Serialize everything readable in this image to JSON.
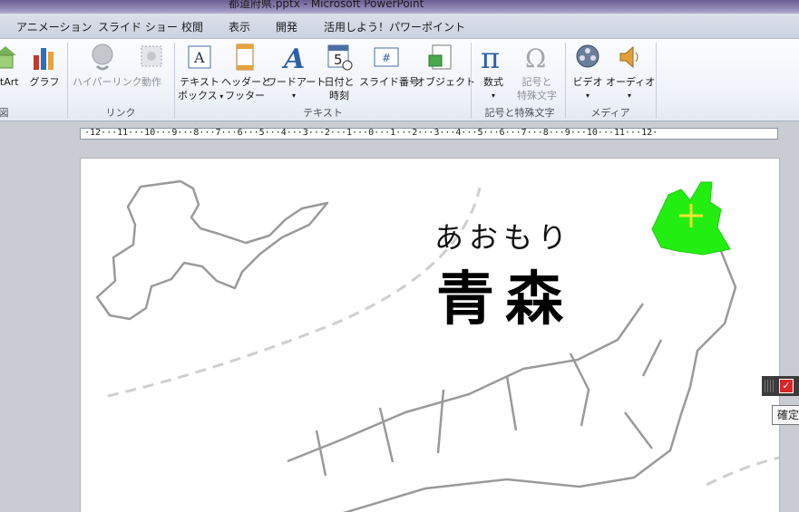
{
  "window": {
    "title": "都道府県.pptx - Microsoft PowerPoint"
  },
  "tabs": [
    "アニメーション",
    "スライド ショー",
    "校閲",
    "表示",
    "開発",
    "活用しよう！パワーポイント"
  ],
  "ribbon": {
    "partial_buttons": {
      "smartart": "rtArt",
      "graph": "グラフ"
    },
    "partial_group_label": "図",
    "links": {
      "hyperlink": "ハイパーリンク",
      "action": "動作",
      "group": "リンク"
    },
    "text": {
      "textbox": [
        "テキスト",
        "ボックス"
      ],
      "header_footer": [
        "ヘッダーと",
        "フッター"
      ],
      "wordart": "ワードアート",
      "datetime": [
        "日付と",
        "時刻"
      ],
      "slide_number": "スライド番号",
      "object": "オブジェクト",
      "group": "テキスト"
    },
    "symbols": {
      "equation": "数式",
      "symbol": [
        "記号と",
        "特殊文字"
      ],
      "group": "記号と特殊文字"
    },
    "media": {
      "video": "ビデオ",
      "audio": "オーディオ",
      "group": "メディア"
    }
  },
  "ruler": {
    "text": "·12···11···10···9···8···7···6···5···4···3···2···1···0···1···2···3···4···5···6···7···8···9···10···11···12·"
  },
  "slide": {
    "kana": "あおもり",
    "kanji": "青森",
    "highlight_color": "#22ee11"
  },
  "floating_toolbar": {
    "tooltip": "確定"
  }
}
